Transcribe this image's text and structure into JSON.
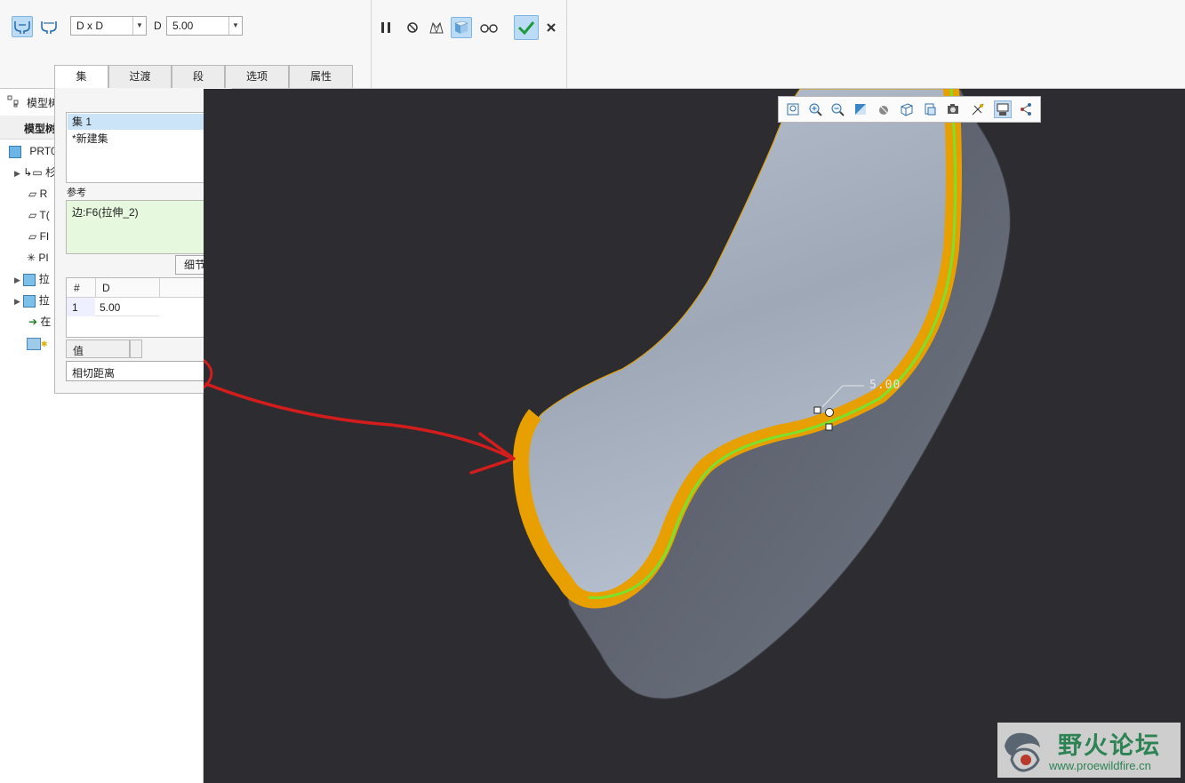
{
  "ribbon": {
    "set_type_value": "D x D",
    "dimension_label": "D",
    "dimension_value": "5.00",
    "tabs": [
      "集",
      "过渡",
      "段",
      "选项",
      "属性"
    ]
  },
  "model_tree": {
    "title": "模型树",
    "subtitle": "模型树",
    "items": [
      "PRT0",
      "杉",
      "R",
      "T(",
      "FI",
      "PI",
      "拉",
      "拉",
      "在",
      ""
    ]
  },
  "panel": {
    "sets": [
      "集 1",
      "*新建集"
    ],
    "references_label": "参考",
    "reference_value": "边:F6(拉伸_2)",
    "details_button": "细节...",
    "table": {
      "headers": [
        "#",
        "D"
      ],
      "rows": [
        [
          "1",
          "5.00"
        ]
      ]
    },
    "value_label": "值",
    "distance_mode": "相切距离"
  },
  "viewport": {
    "dimension_callout": "5.00"
  },
  "watermark": {
    "title": "野火论坛",
    "url": "www.proewildfire.cn"
  },
  "colors": {
    "viewport_bg": "#2d2c31",
    "accent_orange": "#e8a000",
    "accent_green": "#7be12c",
    "annotation_red": "#d31d1d",
    "selection_blue": "#cce4f7"
  }
}
